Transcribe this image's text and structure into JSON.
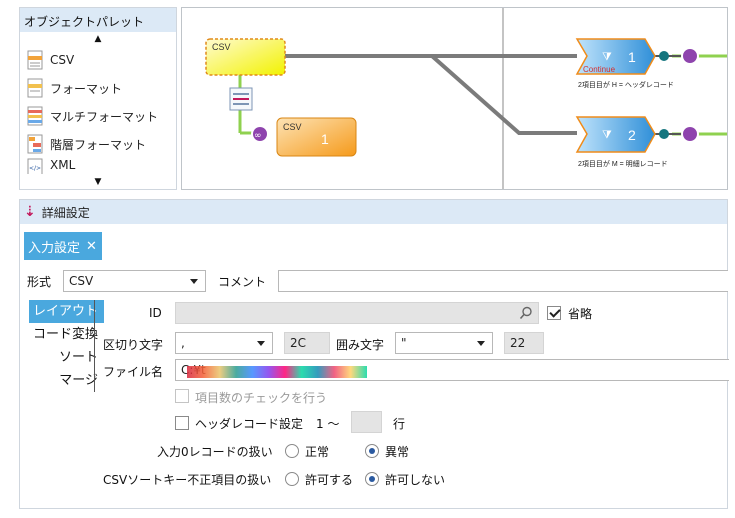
{
  "palette": {
    "title": "オブジェクトパレット",
    "items": [
      {
        "label": "CSV",
        "icon": "csv-file-icon"
      },
      {
        "label": "フォーマット",
        "icon": "format-file-icon"
      },
      {
        "label": "マルチフォーマット",
        "icon": "multi-format-icon"
      },
      {
        "label": "階層フォーマット",
        "icon": "hierarchy-format-icon"
      },
      {
        "label": "XML",
        "icon": "xml-file-icon"
      }
    ]
  },
  "canvas": {
    "csv_source_label": "CSV",
    "csv_target_label": "CSV",
    "csv_target_number": "1",
    "splitter1_number": "1",
    "splitter1_badge": "Continue",
    "splitter1_caption": "2項目目が H = ヘッダレコード",
    "splitter2_number": "2",
    "splitter2_caption": "2項目目が M = 明細レコード"
  },
  "detail": {
    "header": "詳細設定",
    "tab_label": "入力設定",
    "format_label": "形式",
    "format_value": "CSV",
    "comment_label": "コメント",
    "comment_value": "",
    "side_nav": [
      "レイアウト",
      "コード変換",
      "ソート",
      "マージ"
    ],
    "id_label": "ID",
    "id_value": "",
    "omit_label": "省略",
    "omit_checked": true,
    "delimiter_label": "区切り文字",
    "delimiter_value": ",",
    "delimiter_hex": "2C",
    "quote_label": "囲み文字",
    "quote_value": "\"",
    "quote_hex": "22",
    "filename_label": "ファイル名",
    "filename_value": "C:¥t",
    "item_count_check_label": "項目数のチェックを行う",
    "header_record_label": "ヘッダレコード設定",
    "header_record_from": "1 ～",
    "header_record_unit": "行",
    "zero_record_label": "入力0レコードの扱い",
    "zero_record_options": [
      "正常",
      "異常"
    ],
    "zero_record_selected": "異常",
    "sortkey_label": "CSVソートキー不正項目の扱い",
    "sortkey_options": [
      "許可する",
      "許可しない"
    ],
    "sortkey_selected": "許可しない"
  },
  "colors": {
    "accent": "#4aa8de",
    "panel_header": "#dce9f6",
    "connector_green": "#8fd14f",
    "splitter_blue": "#2f8fd8",
    "target_orange": "#f59a1b"
  }
}
